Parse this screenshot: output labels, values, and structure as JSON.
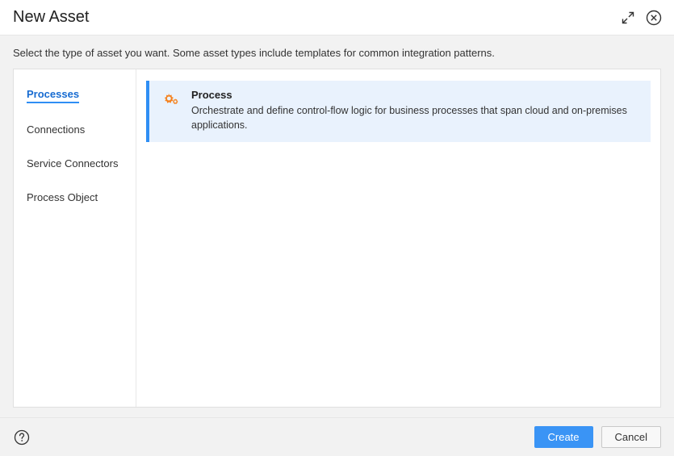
{
  "header": {
    "title": "New Asset"
  },
  "instruction_text": "Select the type of asset you want. Some asset types include templates for common integration patterns.",
  "sidebar": {
    "items": [
      {
        "label": "Processes",
        "active": true
      },
      {
        "label": "Connections",
        "active": false
      },
      {
        "label": "Service Connectors",
        "active": false
      },
      {
        "label": "Process Object",
        "active": false
      }
    ]
  },
  "content": {
    "card": {
      "title": "Process",
      "description": "Orchestrate and define control-flow logic for business processes that span cloud and on-premises applications.",
      "icon": "process-icon"
    }
  },
  "footer": {
    "create_label": "Create",
    "cancel_label": "Cancel"
  },
  "colors": {
    "accent": "#2f8ef4",
    "card_bg": "#e9f2fd",
    "icon_orange": "#f5821f"
  }
}
